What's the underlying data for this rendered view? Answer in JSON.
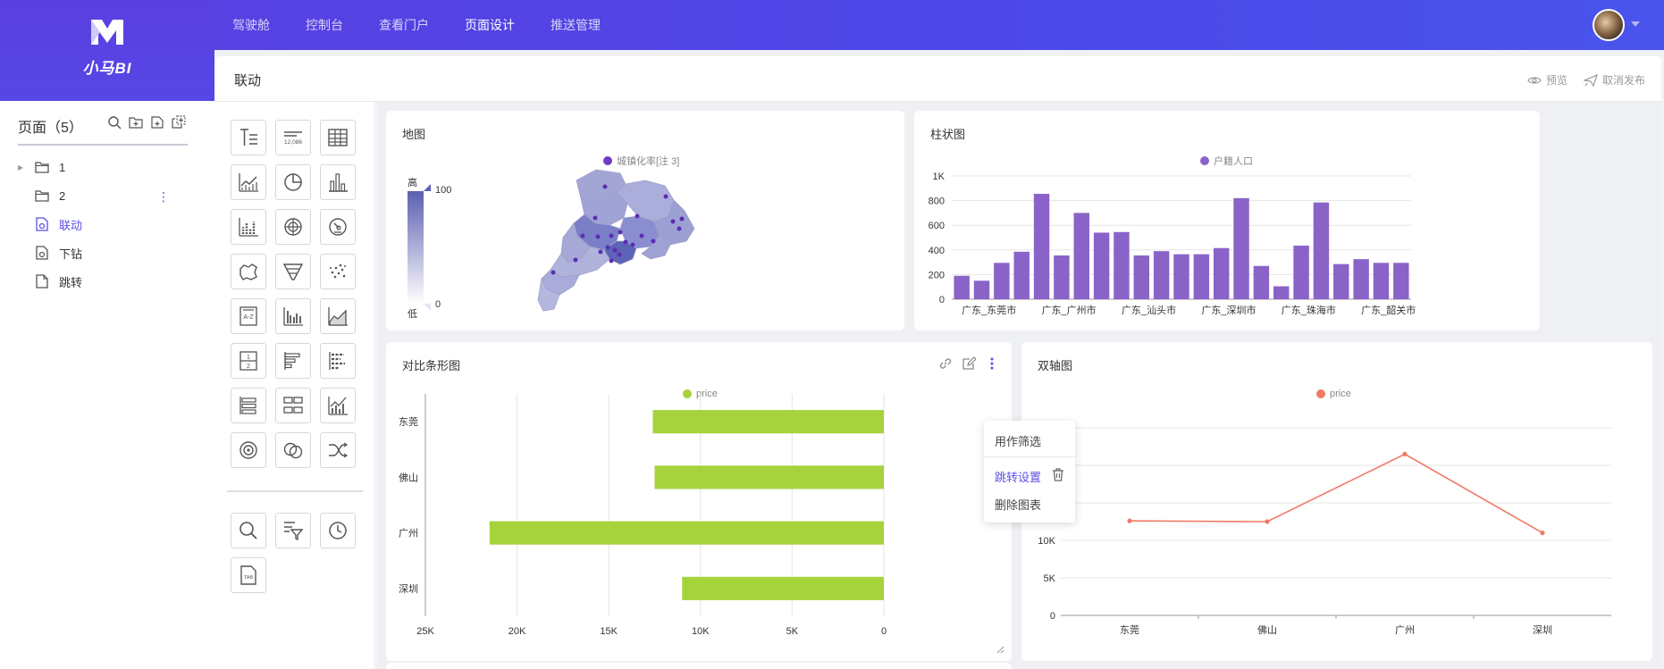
{
  "app": {
    "logo_text": "小马BI"
  },
  "nav": [
    "驾驶舱",
    "控制台",
    "查看门户",
    "页面设计",
    "推送管理"
  ],
  "nav_active": 3,
  "sidebar": {
    "title": "页面（5）",
    "items": [
      {
        "label": "1",
        "icon": "folder-icon",
        "expandable": true
      },
      {
        "label": "2",
        "icon": "folder-icon",
        "expandable": false
      },
      {
        "label": "联动",
        "icon": "page-link-icon",
        "active": true
      },
      {
        "label": "下钻",
        "icon": "page-link-icon"
      },
      {
        "label": "跳转",
        "icon": "page-icon"
      }
    ]
  },
  "main": {
    "title": "联动",
    "preview_label": "预览",
    "unpublish_label": "取消发布"
  },
  "cards": {
    "map": {
      "title": "地图",
      "legend": "城镇化率[注 3]",
      "scale_high": "高",
      "scale_low": "低",
      "scale_max": "100",
      "scale_min": "0"
    },
    "bar": {
      "title": "柱状图",
      "legend": "户籍人口"
    },
    "hbar": {
      "title": "对比条形图",
      "legend": "price"
    },
    "dual": {
      "title": "双轴图",
      "legend": "price"
    }
  },
  "context_menu": {
    "filter_label": "用作筛选",
    "jump_label": "跳转设置",
    "delete_label": "删除图表"
  },
  "colors": {
    "header": "#5146e8",
    "accent": "#5a4ee6",
    "bar": "#8a63c8",
    "hbar": "#a6d33c",
    "line": "#f07a63"
  },
  "chart_data": [
    {
      "type": "bar",
      "title": "柱状图",
      "series": [
        {
          "name": "户籍人口",
          "values": [
            190,
            150,
            295,
            385,
            855,
            355,
            700,
            540,
            545,
            355,
            390,
            365,
            365,
            415,
            820,
            270,
            105,
            435,
            785,
            285,
            325,
            295,
            295
          ]
        }
      ],
      "x_tick_labels": [
        "广东_东莞市",
        "广东_广州市",
        "广东_汕头市",
        "广东_深圳市",
        "广东_珠海市",
        "广东_韶关市"
      ],
      "yticks": [
        "0",
        "200",
        "400",
        "600",
        "800",
        "1K"
      ],
      "ylim": [
        0,
        1000
      ]
    },
    {
      "type": "bar",
      "orientation": "horizontal",
      "title": "对比条形图",
      "categories": [
        "东莞",
        "佛山",
        "广州",
        "深圳"
      ],
      "series": [
        {
          "name": "price",
          "values": [
            12600,
            12500,
            21500,
            11000
          ]
        }
      ],
      "xticks": [
        "25K",
        "20K",
        "15K",
        "10K",
        "5K",
        "0"
      ],
      "xlim": [
        25000,
        0
      ]
    },
    {
      "type": "line",
      "title": "双轴图",
      "categories": [
        "东莞",
        "佛山",
        "广州",
        "深圳"
      ],
      "series": [
        {
          "name": "price",
          "values": [
            12600,
            12500,
            21500,
            11000
          ]
        }
      ],
      "yticks": [
        "0",
        "5K",
        "10K"
      ],
      "ylim": [
        0,
        25000
      ]
    }
  ]
}
